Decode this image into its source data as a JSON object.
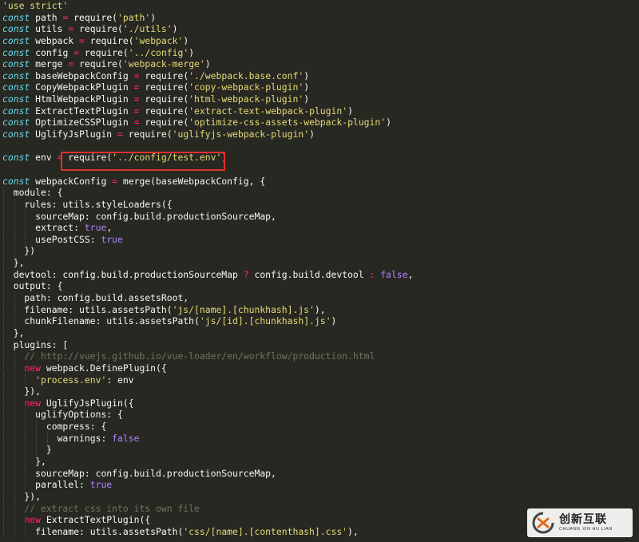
{
  "colors": {
    "background": "#272822",
    "keyword": "#66d9ef",
    "string": "#e6db74",
    "operator": "#f92672",
    "boolean": "#ae81ff",
    "comment": "#75715e",
    "plain": "#f8f8f2",
    "highlight_border": "#e0312c"
  },
  "editor": {
    "lines": [
      [
        {
          "t": "str",
          "v": "'use strict'"
        }
      ],
      [
        {
          "t": "kw",
          "v": "const"
        },
        {
          "t": "pl",
          "v": " path "
        },
        {
          "t": "op",
          "v": "="
        },
        {
          "t": "pl",
          "v": " require("
        },
        {
          "t": "str",
          "v": "'path'"
        },
        {
          "t": "pl",
          "v": ")"
        }
      ],
      [
        {
          "t": "kw",
          "v": "const"
        },
        {
          "t": "pl",
          "v": " utils "
        },
        {
          "t": "op",
          "v": "="
        },
        {
          "t": "pl",
          "v": " require("
        },
        {
          "t": "str",
          "v": "'./utils'"
        },
        {
          "t": "pl",
          "v": ")"
        }
      ],
      [
        {
          "t": "kw",
          "v": "const"
        },
        {
          "t": "pl",
          "v": " webpack "
        },
        {
          "t": "op",
          "v": "="
        },
        {
          "t": "pl",
          "v": " require("
        },
        {
          "t": "str",
          "v": "'webpack'"
        },
        {
          "t": "pl",
          "v": ")"
        }
      ],
      [
        {
          "t": "kw",
          "v": "const"
        },
        {
          "t": "pl",
          "v": " config "
        },
        {
          "t": "op",
          "v": "="
        },
        {
          "t": "pl",
          "v": " require("
        },
        {
          "t": "str",
          "v": "'../config'"
        },
        {
          "t": "pl",
          "v": ")"
        }
      ],
      [
        {
          "t": "kw",
          "v": "const"
        },
        {
          "t": "pl",
          "v": " merge "
        },
        {
          "t": "op",
          "v": "="
        },
        {
          "t": "pl",
          "v": " require("
        },
        {
          "t": "str",
          "v": "'webpack-merge'"
        },
        {
          "t": "pl",
          "v": ")"
        }
      ],
      [
        {
          "t": "kw",
          "v": "const"
        },
        {
          "t": "pl",
          "v": " baseWebpackConfig "
        },
        {
          "t": "op",
          "v": "="
        },
        {
          "t": "pl",
          "v": " require("
        },
        {
          "t": "str",
          "v": "'./webpack.base.conf'"
        },
        {
          "t": "pl",
          "v": ")"
        }
      ],
      [
        {
          "t": "kw",
          "v": "const"
        },
        {
          "t": "pl",
          "v": " CopyWebpackPlugin "
        },
        {
          "t": "op",
          "v": "="
        },
        {
          "t": "pl",
          "v": " require("
        },
        {
          "t": "str",
          "v": "'copy-webpack-plugin'"
        },
        {
          "t": "pl",
          "v": ")"
        }
      ],
      [
        {
          "t": "kw",
          "v": "const"
        },
        {
          "t": "pl",
          "v": " HtmlWebpackPlugin "
        },
        {
          "t": "op",
          "v": "="
        },
        {
          "t": "pl",
          "v": " require("
        },
        {
          "t": "str",
          "v": "'html-webpack-plugin'"
        },
        {
          "t": "pl",
          "v": ")"
        }
      ],
      [
        {
          "t": "kw",
          "v": "const"
        },
        {
          "t": "pl",
          "v": " ExtractTextPlugin "
        },
        {
          "t": "op",
          "v": "="
        },
        {
          "t": "pl",
          "v": " require("
        },
        {
          "t": "str",
          "v": "'extract-text-webpack-plugin'"
        },
        {
          "t": "pl",
          "v": ")"
        }
      ],
      [
        {
          "t": "kw",
          "v": "const"
        },
        {
          "t": "pl",
          "v": " OptimizeCSSPlugin "
        },
        {
          "t": "op",
          "v": "="
        },
        {
          "t": "pl",
          "v": " require("
        },
        {
          "t": "str",
          "v": "'optimize-css-assets-webpack-plugin'"
        },
        {
          "t": "pl",
          "v": ")"
        }
      ],
      [
        {
          "t": "kw",
          "v": "const"
        },
        {
          "t": "pl",
          "v": " UglifyJsPlugin "
        },
        {
          "t": "op",
          "v": "="
        },
        {
          "t": "pl",
          "v": " require("
        },
        {
          "t": "str",
          "v": "'uglifyjs-webpack-plugin'"
        },
        {
          "t": "pl",
          "v": ")"
        }
      ],
      [],
      [
        {
          "t": "kw",
          "v": "const"
        },
        {
          "t": "pl",
          "v": " env "
        },
        {
          "t": "op",
          "v": "="
        },
        {
          "t": "pl",
          "v": " require("
        },
        {
          "t": "str",
          "v": "'../config/test.env'"
        },
        {
          "t": "pl",
          "v": ")"
        }
      ],
      [],
      [
        {
          "t": "kw",
          "v": "const"
        },
        {
          "t": "pl",
          "v": " webpackConfig "
        },
        {
          "t": "op",
          "v": "="
        },
        {
          "t": "pl",
          "v": " merge(baseWebpackConfig, {"
        }
      ],
      [
        {
          "t": "pl",
          "v": "  module: {"
        }
      ],
      [
        {
          "t": "pl",
          "v": "    rules: utils.styleLoaders({"
        }
      ],
      [
        {
          "t": "pl",
          "v": "      sourceMap: config.build.productionSourceMap,"
        }
      ],
      [
        {
          "t": "pl",
          "v": "      extract: "
        },
        {
          "t": "bool",
          "v": "true"
        },
        {
          "t": "pl",
          "v": ","
        }
      ],
      [
        {
          "t": "pl",
          "v": "      usePostCSS: "
        },
        {
          "t": "bool",
          "v": "true"
        }
      ],
      [
        {
          "t": "pl",
          "v": "    })"
        }
      ],
      [
        {
          "t": "pl",
          "v": "  },"
        }
      ],
      [
        {
          "t": "pl",
          "v": "  devtool: config.build.productionSourceMap "
        },
        {
          "t": "op",
          "v": "?"
        },
        {
          "t": "pl",
          "v": " config.build.devtool "
        },
        {
          "t": "op",
          "v": ":"
        },
        {
          "t": "pl",
          "v": " "
        },
        {
          "t": "bool",
          "v": "false"
        },
        {
          "t": "pl",
          "v": ","
        }
      ],
      [
        {
          "t": "pl",
          "v": "  output: {"
        }
      ],
      [
        {
          "t": "pl",
          "v": "    path: config.build.assetsRoot,"
        }
      ],
      [
        {
          "t": "pl",
          "v": "    filename: utils.assetsPath("
        },
        {
          "t": "str",
          "v": "'js/[name].[chunkhash].js'"
        },
        {
          "t": "pl",
          "v": "),"
        }
      ],
      [
        {
          "t": "pl",
          "v": "    chunkFilename: utils.assetsPath("
        },
        {
          "t": "str",
          "v": "'js/[id].[chunkhash].js'"
        },
        {
          "t": "pl",
          "v": ")"
        }
      ],
      [
        {
          "t": "pl",
          "v": "  },"
        }
      ],
      [
        {
          "t": "pl",
          "v": "  plugins: ["
        }
      ],
      [
        {
          "t": "cm",
          "v": "    // http://vuejs.github.io/vue-loader/en/workflow/production.html"
        }
      ],
      [
        {
          "t": "pl",
          "v": "    "
        },
        {
          "t": "op",
          "v": "new"
        },
        {
          "t": "pl",
          "v": " webpack.DefinePlugin({"
        }
      ],
      [
        {
          "t": "pl",
          "v": "      "
        },
        {
          "t": "str",
          "v": "'process.env'"
        },
        {
          "t": "pl",
          "v": ": env"
        }
      ],
      [
        {
          "t": "pl",
          "v": "    }),"
        }
      ],
      [
        {
          "t": "pl",
          "v": "    "
        },
        {
          "t": "op",
          "v": "new"
        },
        {
          "t": "pl",
          "v": " UglifyJsPlugin({"
        }
      ],
      [
        {
          "t": "pl",
          "v": "      uglifyOptions: {"
        }
      ],
      [
        {
          "t": "pl",
          "v": "        compress: {"
        }
      ],
      [
        {
          "t": "pl",
          "v": "          warnings: "
        },
        {
          "t": "bool",
          "v": "false"
        }
      ],
      [
        {
          "t": "pl",
          "v": "        }"
        }
      ],
      [
        {
          "t": "pl",
          "v": "      },"
        }
      ],
      [
        {
          "t": "pl",
          "v": "      sourceMap: config.build.productionSourceMap,"
        }
      ],
      [
        {
          "t": "pl",
          "v": "      parallel: "
        },
        {
          "t": "bool",
          "v": "true"
        }
      ],
      [
        {
          "t": "pl",
          "v": "    }),"
        }
      ],
      [
        {
          "t": "cm",
          "v": "    // extract css into its own file"
        }
      ],
      [
        {
          "t": "pl",
          "v": "    "
        },
        {
          "t": "op",
          "v": "new"
        },
        {
          "t": "pl",
          "v": " ExtractTextPlugin({"
        }
      ],
      [
        {
          "t": "pl",
          "v": "      filename: utils.assetsPath("
        },
        {
          "t": "str",
          "v": "'css/[name].[contenthash].css'"
        },
        {
          "t": "pl",
          "v": "),"
        }
      ]
    ]
  },
  "watermark": {
    "logo_icon": "chuangxin-logo-icon",
    "name_cn": "创新互联",
    "name_en": "CHUANG XIN HU LIAN"
  }
}
